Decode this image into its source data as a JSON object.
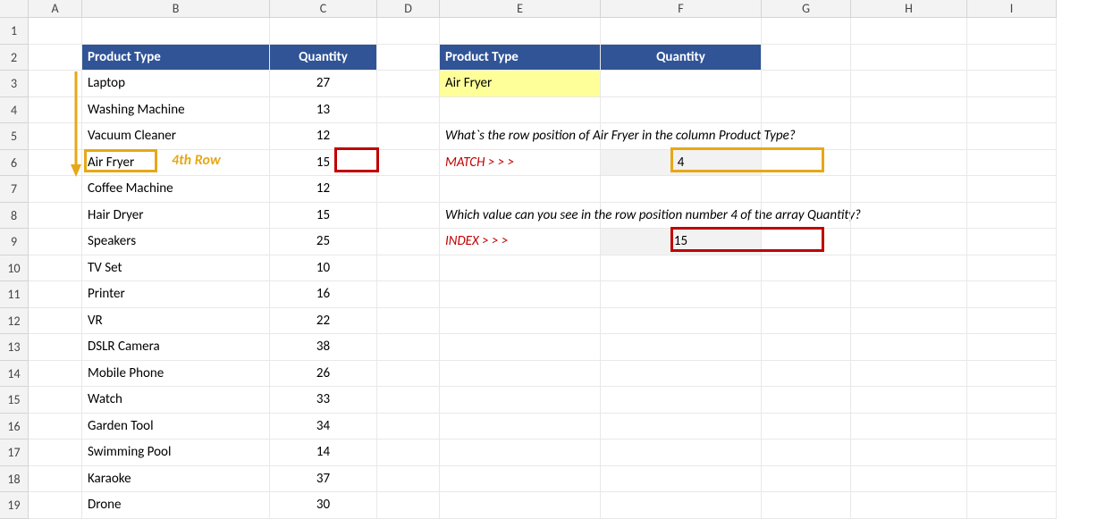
{
  "columns": [
    "A",
    "B",
    "C",
    "D",
    "E",
    "F",
    "G",
    "H",
    "I"
  ],
  "rowCount": 19,
  "table": {
    "headers": {
      "product": "Product Type",
      "quantity": "Quantity"
    },
    "rows": [
      {
        "product": "Laptop",
        "quantity": "27"
      },
      {
        "product": "Washing Machine",
        "quantity": "13"
      },
      {
        "product": "Vacuum Cleaner",
        "quantity": "12"
      },
      {
        "product": "Air Fryer",
        "quantity": "15"
      },
      {
        "product": "Coffee Machine",
        "quantity": "12"
      },
      {
        "product": "Hair Dryer",
        "quantity": "15"
      },
      {
        "product": "Speakers",
        "quantity": "25"
      },
      {
        "product": "TV Set",
        "quantity": "10"
      },
      {
        "product": "Printer",
        "quantity": "16"
      },
      {
        "product": "VR",
        "quantity": "22"
      },
      {
        "product": "DSLR Camera",
        "quantity": "38"
      },
      {
        "product": "Mobile Phone",
        "quantity": "26"
      },
      {
        "product": "Watch",
        "quantity": "33"
      },
      {
        "product": "Garden Tool",
        "quantity": "34"
      },
      {
        "product": "Swimming Pool",
        "quantity": "14"
      },
      {
        "product": "Karaoke",
        "quantity": "37"
      },
      {
        "product": "Drone",
        "quantity": "30"
      }
    ]
  },
  "lookup": {
    "headers": {
      "product": "Product Type",
      "quantity": "Quantity"
    },
    "value": "Air Fryer"
  },
  "questions": {
    "match_q": "What`s the row position of Air Fryer in the column Product Type?",
    "match_label": "MATCH > > >",
    "match_result": "4",
    "index_q": "Which value can you see in the row position number 4 of the array Quantity?",
    "index_label": "INDEX > > >",
    "index_result": "15"
  },
  "annotation": {
    "fourth_row": "4th Row"
  }
}
